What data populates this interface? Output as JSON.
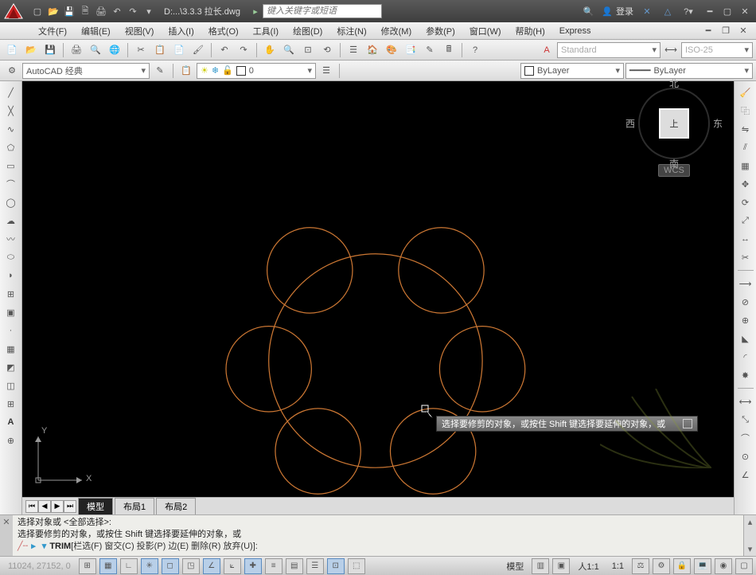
{
  "title": {
    "doc": "D:...\\3.3.3 拉长.dwg",
    "search_placeholder": "键入关键字或短语",
    "login": "登录"
  },
  "menu": {
    "file": "文件(F)",
    "edit": "编辑(E)",
    "view": "视图(V)",
    "insert": "插入(I)",
    "format": "格式(O)",
    "tools": "工具(I)",
    "draw": "绘图(D)",
    "dim": "标注(N)",
    "modify": "修改(M)",
    "param": "参数(P)",
    "window": "窗口(W)",
    "help": "帮助(H)",
    "express": "Express"
  },
  "workspace": "AutoCAD 经典",
  "style_name": "Standard",
  "dim_style": "ISO-25",
  "layer_name": "0",
  "bylayer": "ByLayer",
  "linetype": "ByLayer",
  "viewcube": {
    "n": "北",
    "s": "南",
    "e": "东",
    "w": "西",
    "top": "上",
    "wcs": "WCS"
  },
  "tabs": {
    "model": "模型",
    "layout1": "布局1",
    "layout2": "布局2"
  },
  "axes": {
    "x": "X",
    "y": "Y"
  },
  "tooltip": "选择要修剪的对象，或按住 Shift 键选择要延伸的对象，或",
  "cmd": {
    "l1": "选择对象或 <全部选择>:",
    "l2": "选择要修剪的对象，或按住 Shift 键选择要延伸的对象，或",
    "name": "TRIM",
    "opts": " [栏选(F) 窗交(C) 投影(P) 边(E) 删除(R) 放弃(U)]:"
  },
  "coords": "11024, 27152, 0",
  "status": {
    "model": "模型",
    "ratio": "人1:1",
    "scale": "1:1"
  }
}
